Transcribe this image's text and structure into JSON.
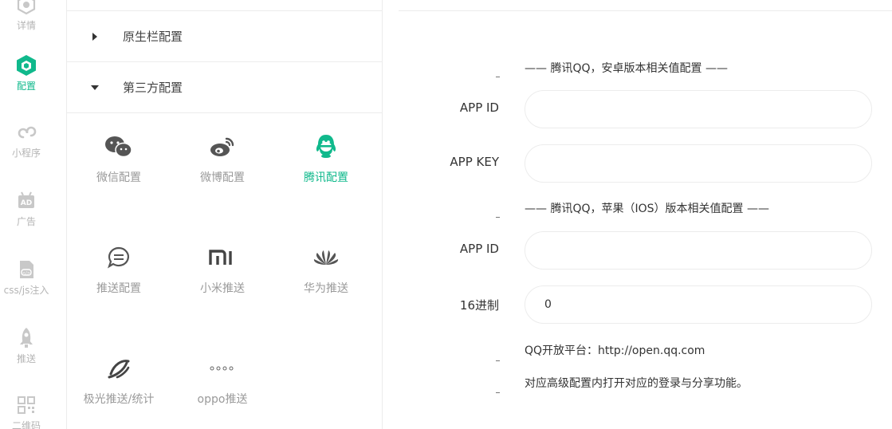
{
  "colors": {
    "accent": "#10b98c",
    "inactive": "#c0c0c0"
  },
  "rail": [
    {
      "label": "详情",
      "icon": "details-icon"
    },
    {
      "label": "配置",
      "icon": "config-cube-icon",
      "active": true
    },
    {
      "label": "小程序",
      "icon": "mini-program-icon"
    },
    {
      "label": "广告",
      "icon": "ad-icon"
    },
    {
      "label": "css/js注入",
      "icon": "code-file-icon"
    },
    {
      "label": "推送",
      "icon": "rocket-icon"
    },
    {
      "label": "二维码",
      "icon": "qrcode-icon"
    }
  ],
  "panel": {
    "sections": [
      {
        "label": "原生栏配置",
        "expanded": false
      },
      {
        "label": "第三方配置",
        "expanded": true
      }
    ],
    "items": [
      {
        "label": "微信配置",
        "icon": "wechat-icon"
      },
      {
        "label": "微博配置",
        "icon": "weibo-icon"
      },
      {
        "label": "腾讯配置",
        "icon": "qq-icon",
        "active": true
      },
      {
        "label": "推送配置",
        "icon": "chat-bubble-icon"
      },
      {
        "label": "小米推送",
        "icon": "xiaomi-icon"
      },
      {
        "label": "华为推送",
        "icon": "huawei-icon"
      },
      {
        "label": "极光推送/统计",
        "icon": "jpush-icon"
      },
      {
        "label": "oppo推送",
        "icon": "oppo-icon"
      }
    ]
  },
  "form": {
    "android_title": "—— 腾讯QQ，安卓版本相关值配置 ——",
    "android_app_id_label": "APP ID",
    "android_app_id_value": "",
    "android_app_key_label": "APP KEY",
    "android_app_key_value": "",
    "ios_title": "—— 腾讯QQ，苹果（IOS）版本相关值配置 ——",
    "ios_app_id_label": "APP ID",
    "ios_app_id_value": "",
    "hex_label": "16进制",
    "hex_value": "0",
    "info_platform": "QQ开放平台：http://open.qq.com",
    "info_note": "对应高级配置内打开对应的登录与分享功能。"
  }
}
